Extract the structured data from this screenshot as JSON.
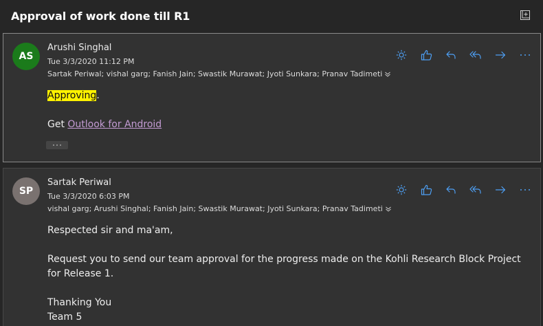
{
  "thread": {
    "title": "Approval of work done till R1"
  },
  "icons": {
    "expand": "expand-window-icon",
    "actions": [
      "sun-icon",
      "like-icon",
      "reply-icon",
      "reply-all-icon",
      "forward-icon",
      "more-icon"
    ],
    "recipients_chevron": "chevron-down-icon"
  },
  "colors": {
    "background": "#262626",
    "card": "#323232",
    "accent": "#4ea0f5",
    "avatar_as": "#1b7b1b",
    "avatar_sp": "#7a7270",
    "highlight": "#fff200",
    "link": "#c39bd3"
  },
  "messages": [
    {
      "initials": "AS",
      "sender": "Arushi Singhal",
      "date": "Tue 3/3/2020 11:12 PM",
      "recipients": "Sartak Periwal; vishal garg; Fanish Jain; Swastik Murawat; Jyoti Sunkara; Pranav Tadimeti",
      "body_highlight": "Approving",
      "body_after_highlight": ".",
      "body_get_prefix": "Get ",
      "body_link": "Outlook for Android",
      "more_label": "···"
    },
    {
      "initials": "SP",
      "sender": "Sartak Periwal",
      "date": "Tue 3/3/2020 6:03 PM",
      "recipients": "vishal garg; Arushi Singhal; Fanish Jain; Swastik Murawat; Jyoti Sunkara; Pranav Tadimeti",
      "greeting": "Respected sir and ma'am,",
      "request": "Request you to send our team approval for the progress made on the Kohli Research Block Project for Release 1.",
      "closing1": "Thanking You",
      "closing2": "Team 5"
    }
  ]
}
